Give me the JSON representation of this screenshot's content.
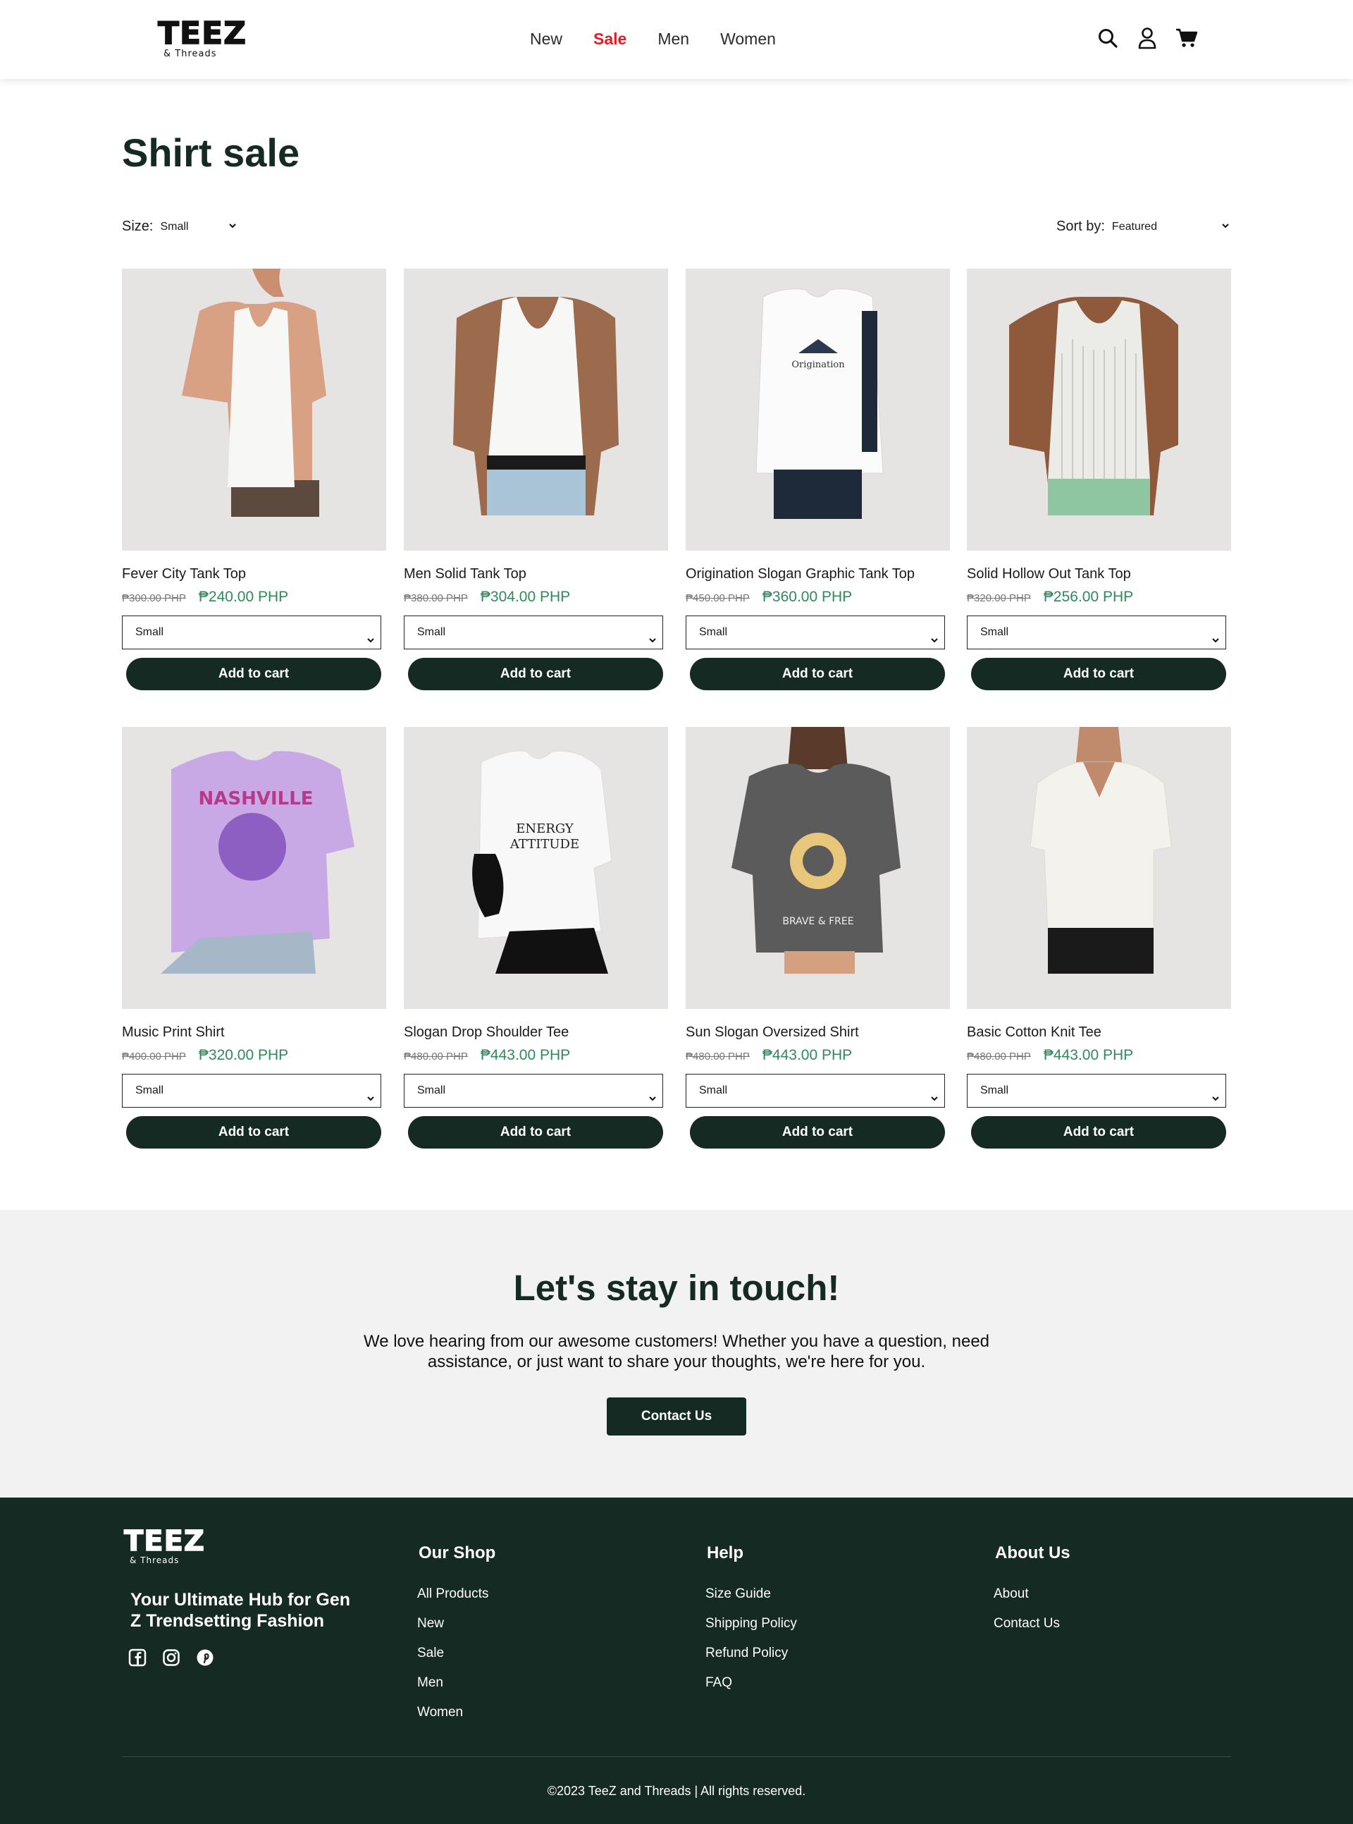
{
  "header": {
    "logo": {
      "main": "TEEZ",
      "sub": "& Threads"
    },
    "nav": [
      {
        "label": "New"
      },
      {
        "label": "Sale",
        "active": true
      },
      {
        "label": "Men"
      },
      {
        "label": "Women"
      }
    ],
    "icons": [
      "search-icon",
      "user-icon",
      "cart-icon"
    ],
    "active_color": "#e31b23"
  },
  "page": {
    "title": "Shirt sale",
    "filters": {
      "size_label": "Size:",
      "size_value": "Small",
      "sort_label": "Sort by:",
      "sort_value": "Featured"
    }
  },
  "products": [
    {
      "name": "Fever City Tank Top",
      "old_price": "₱300.00 PHP",
      "price": "₱240.00 PHP",
      "size": "Small",
      "cta": "Add to cart"
    },
    {
      "name": "Men Solid Tank Top",
      "old_price": "₱380.00 PHP",
      "price": "₱304.00 PHP",
      "size": "Small",
      "cta": "Add to cart"
    },
    {
      "name": "Origination Slogan Graphic Tank Top",
      "old_price": "₱450.00 PHP",
      "price": "₱360.00 PHP",
      "size": "Small",
      "cta": "Add to cart"
    },
    {
      "name": "Solid Hollow Out Tank Top",
      "old_price": "₱320.00 PHP",
      "price": "₱256.00 PHP",
      "size": "Small",
      "cta": "Add to cart"
    },
    {
      "name": "Music Print Shirt",
      "old_price": "₱400.00 PHP",
      "price": "₱320.00 PHP",
      "size": "Small",
      "cta": "Add to cart"
    },
    {
      "name": "Slogan Drop Shoulder Tee",
      "old_price": "₱480.00 PHP",
      "price": "₱443.00 PHP",
      "size": "Small",
      "cta": "Add to cart"
    },
    {
      "name": "Sun Slogan Oversized Shirt",
      "old_price": "₱480.00 PHP",
      "price": "₱443.00 PHP",
      "size": "Small",
      "cta": "Add to cart"
    },
    {
      "name": "Basic Cotton Knit Tee",
      "old_price": "₱480.00 PHP",
      "price": "₱443.00 PHP",
      "size": "Small",
      "cta": "Add to cart"
    }
  ],
  "contact": {
    "title": "Let's stay in touch!",
    "text": "We love hearing from our awesome customers! Whether you have a question, need assistance, or just want to share your thoughts, we're here for you.",
    "button": "Contact Us"
  },
  "footer": {
    "logo": {
      "main": "TEEZ",
      "sub": "& Threads"
    },
    "tagline": "Your Ultimate Hub for Gen Z Trendsetting Fashion",
    "social": [
      "facebook-icon",
      "instagram-icon",
      "pinterest-icon"
    ],
    "columns": [
      {
        "title": "Our Shop",
        "links": [
          "All Products",
          "New",
          "Sale",
          "Men",
          "Women"
        ]
      },
      {
        "title": "Help",
        "links": [
          "Size Guide",
          "Shipping Policy",
          "Refund Policy",
          "FAQ"
        ]
      },
      {
        "title": "About Us",
        "links": [
          "About",
          "Contact Us"
        ]
      }
    ],
    "copyright": "©2023 TeeZ and Threads | All rights reserved."
  },
  "colors": {
    "brand_dark": "#142a22",
    "sale_price": "#2f8a5a",
    "image_bg": "#e6e3e3",
    "contact_bg": "#f2f2f2"
  }
}
